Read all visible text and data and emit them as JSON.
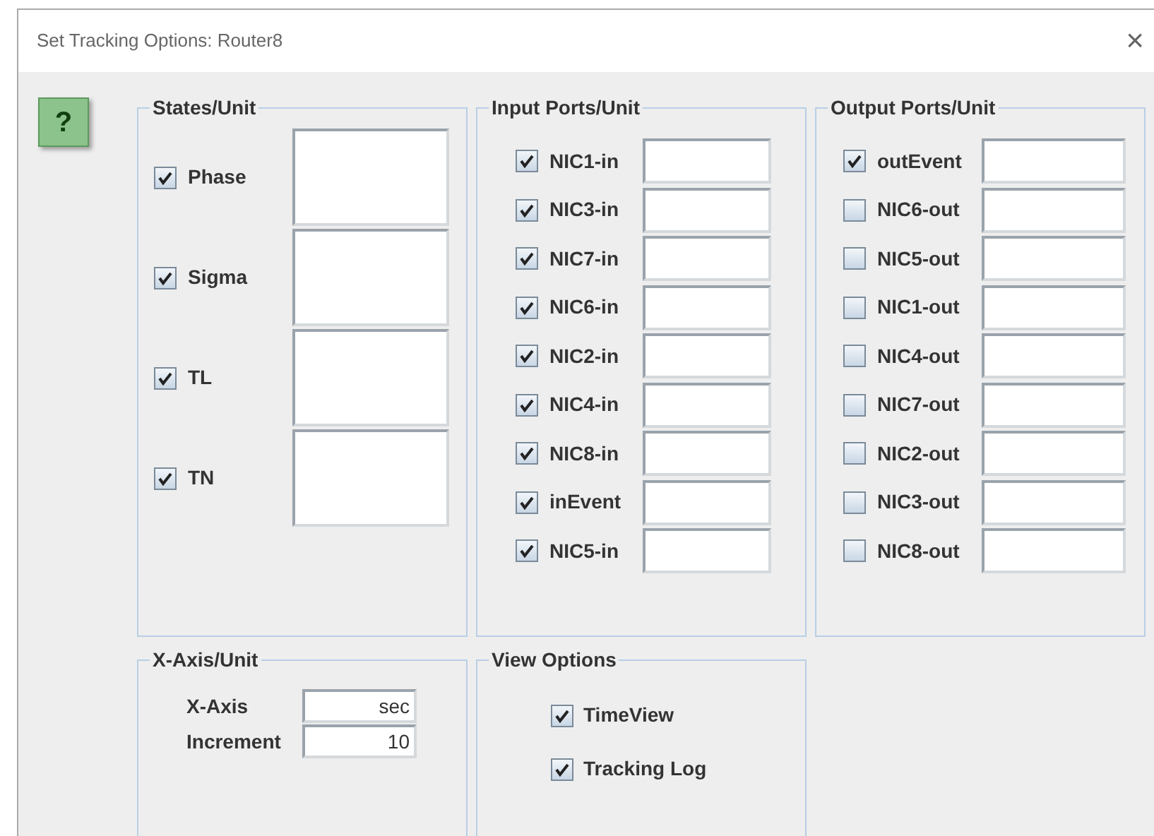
{
  "window": {
    "title": "Set Tracking Options: Router8",
    "close": "×"
  },
  "help": {
    "label": "?"
  },
  "states": {
    "title": "States/Unit",
    "items": [
      {
        "label": "Phase",
        "checked": true
      },
      {
        "label": "Sigma",
        "checked": true
      },
      {
        "label": "TL",
        "checked": true
      },
      {
        "label": "TN",
        "checked": true
      }
    ]
  },
  "input_ports": {
    "title": "Input Ports/Unit",
    "items": [
      {
        "label": "NIC1-in",
        "checked": true
      },
      {
        "label": "NIC3-in",
        "checked": true
      },
      {
        "label": "NIC7-in",
        "checked": true
      },
      {
        "label": "NIC6-in",
        "checked": true
      },
      {
        "label": "NIC2-in",
        "checked": true
      },
      {
        "label": "NIC4-in",
        "checked": true
      },
      {
        "label": "NIC8-in",
        "checked": true
      },
      {
        "label": "inEvent",
        "checked": true
      },
      {
        "label": "NIC5-in",
        "checked": true
      }
    ]
  },
  "output_ports": {
    "title": "Output Ports/Unit",
    "items": [
      {
        "label": "outEvent",
        "checked": true
      },
      {
        "label": "NIC6-out",
        "checked": false
      },
      {
        "label": "NIC5-out",
        "checked": false
      },
      {
        "label": "NIC1-out",
        "checked": false
      },
      {
        "label": "NIC4-out",
        "checked": false
      },
      {
        "label": "NIC7-out",
        "checked": false
      },
      {
        "label": "NIC2-out",
        "checked": false
      },
      {
        "label": "NIC3-out",
        "checked": false
      },
      {
        "label": "NIC8-out",
        "checked": false
      }
    ]
  },
  "x_axis": {
    "title": "X-Axis/Unit",
    "fields": [
      {
        "label": "X-Axis",
        "value": "sec"
      },
      {
        "label": "Increment",
        "value": "10"
      }
    ]
  },
  "view_options": {
    "title": "View Options",
    "items": [
      {
        "label": "TimeView",
        "checked": true
      },
      {
        "label": "Tracking Log",
        "checked": true
      }
    ]
  }
}
